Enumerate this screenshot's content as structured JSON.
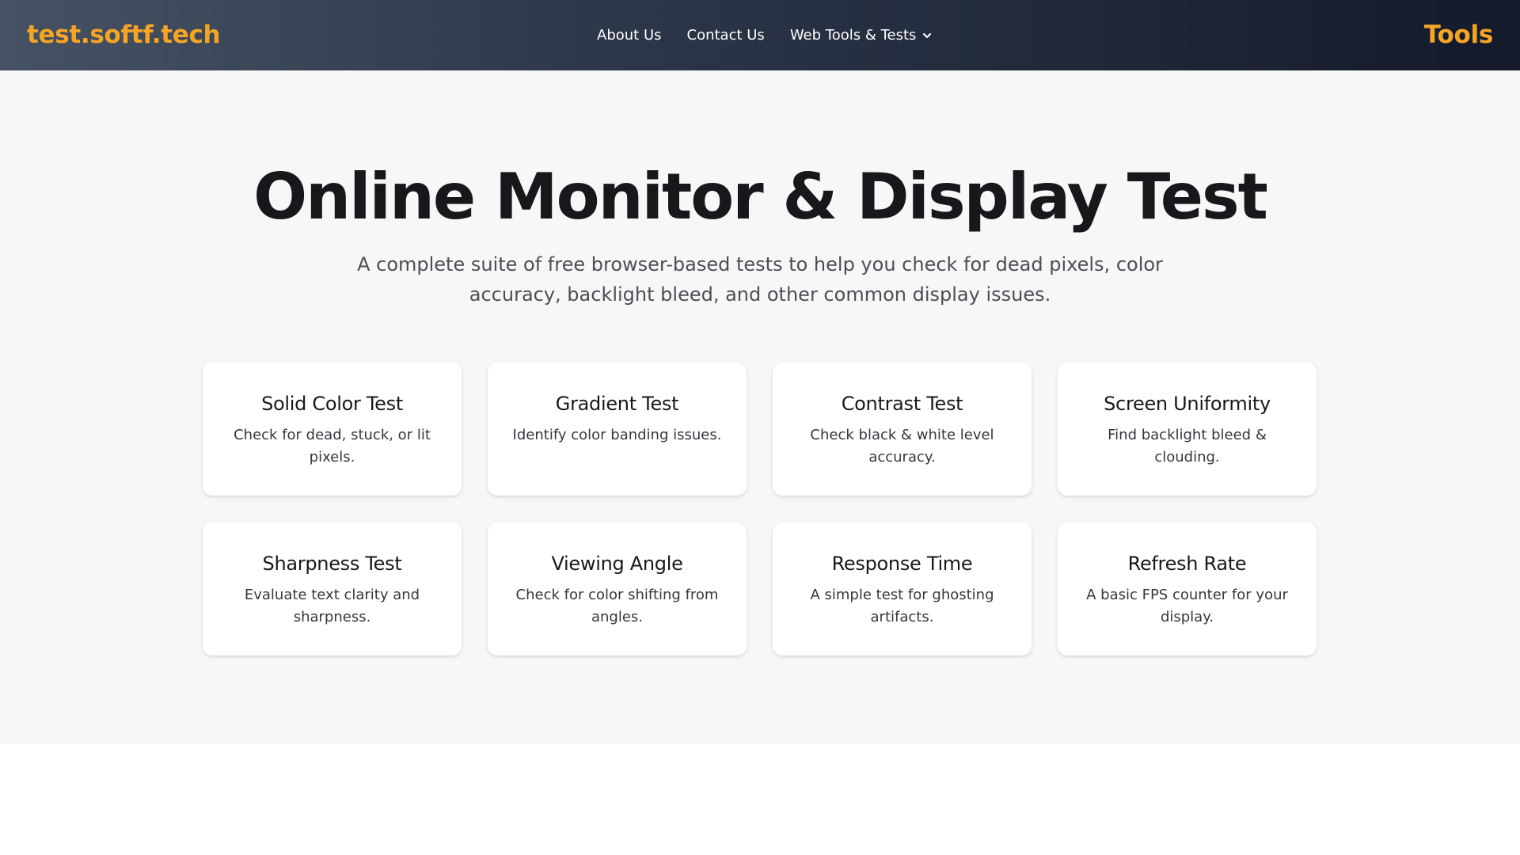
{
  "header": {
    "logo": "test.softf.tech",
    "nav": {
      "about": "About Us",
      "contact": "Contact Us",
      "tools_dropdown": "Web Tools & Tests"
    },
    "right_label": "Tools"
  },
  "hero": {
    "title": "Online Monitor & Display Test",
    "subtitle": "A complete suite of free browser-based tests to help you check for dead pixels, color accuracy, backlight bleed, and other common display issues."
  },
  "cards": [
    {
      "title": "Solid Color Test",
      "desc": "Check for dead, stuck, or lit pixels."
    },
    {
      "title": "Gradient Test",
      "desc": "Identify color banding issues."
    },
    {
      "title": "Contrast Test",
      "desc": "Check black & white level accuracy."
    },
    {
      "title": "Screen Uniformity",
      "desc": "Find backlight bleed & clouding."
    },
    {
      "title": "Sharpness Test",
      "desc": "Evaluate text clarity and sharpness."
    },
    {
      "title": "Viewing Angle",
      "desc": "Check for color shifting from angles."
    },
    {
      "title": "Response Time",
      "desc": "A simple test for ghosting artifacts."
    },
    {
      "title": "Refresh Rate",
      "desc": "A basic FPS counter for your display."
    }
  ],
  "colors": {
    "brand": "#f5a524",
    "header_start": "#465263",
    "header_end": "#141a2b",
    "hero_bg": "#f7f7f7"
  },
  "icons": {
    "dropdown": "chevron-down-icon"
  }
}
